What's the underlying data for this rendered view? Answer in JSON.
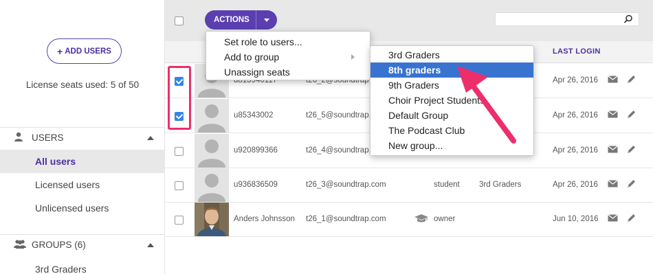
{
  "sidebar": {
    "add_users_label": "ADD USERS",
    "seats_text": "License seats used: 5 of 50",
    "users_section": {
      "label": "USERS",
      "icon": "user-icon"
    },
    "users_items": [
      {
        "label": "All users",
        "active": true
      },
      {
        "label": "Licensed users",
        "active": false
      },
      {
        "label": "Unlicensed users",
        "active": false
      }
    ],
    "groups_section": {
      "label": "GROUPS (6)",
      "icon": "group-icon"
    },
    "groups_items": [
      {
        "label": "3rd Graders"
      }
    ]
  },
  "toolbar": {
    "actions_label": "ACTIONS",
    "search_placeholder": ""
  },
  "table": {
    "headers": {
      "last_login": "LAST LOGIN"
    },
    "rows": [
      {
        "username": "u813940117",
        "email": "t26_2@soundtrap.com",
        "role": "",
        "group": "",
        "last_login": "Apr 26, 2016",
        "checked": true
      },
      {
        "username": "u85343002",
        "email": "t26_5@soundtrap.com",
        "role": "",
        "group": "",
        "last_login": "Apr 26, 2016",
        "checked": true
      },
      {
        "username": "u920899366",
        "email": "t26_4@soundtrap.com",
        "role": "",
        "group": "",
        "last_login": "Apr 26, 2016",
        "checked": false
      },
      {
        "username": "u936836509",
        "email": "t26_3@soundtrap.com",
        "role": "student",
        "group": "3rd Graders",
        "last_login": "Apr 26, 2016",
        "checked": false
      },
      {
        "username": "Anders Johnsson",
        "email": "t26_1@soundtrap.com",
        "role": "owner",
        "group": "",
        "last_login": "Jun 10, 2016",
        "checked": false,
        "owner_icon": "graduation-cap-icon"
      }
    ]
  },
  "actions_menu": {
    "items": [
      {
        "label": "Set role to users..."
      },
      {
        "label": "Add to group",
        "has_submenu": true
      },
      {
        "label": "Unassign seats"
      }
    ]
  },
  "group_submenu": {
    "items": [
      {
        "label": "3rd Graders",
        "highlighted": false
      },
      {
        "label": "8th graders",
        "highlighted": true
      },
      {
        "label": "9th Graders",
        "highlighted": false
      },
      {
        "label": "Choir Project Students",
        "highlighted": false
      },
      {
        "label": "Default Group",
        "highlighted": false
      },
      {
        "label": "The Podcast Club",
        "highlighted": false
      },
      {
        "label": "New group...",
        "highlighted": false
      }
    ]
  },
  "colors": {
    "accent": "#5b3fb0",
    "highlight": "#3874cf",
    "annotation": "#ee2d6b",
    "checkbox": "#2f86e9"
  }
}
